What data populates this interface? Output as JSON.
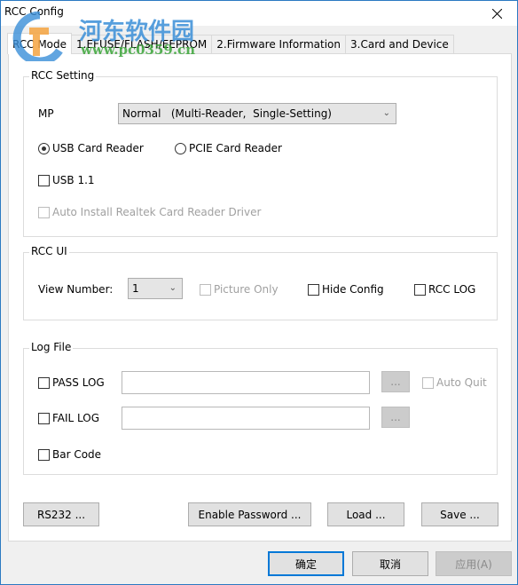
{
  "window": {
    "title": "RCC Config",
    "close_icon": "close-icon"
  },
  "watermark": {
    "text": "河东软件园",
    "url": "www.pc0359.cn"
  },
  "tabs": [
    {
      "label": "RCC Mode",
      "active": true
    },
    {
      "label": "1.EFUSE/FLASH/EEPROM",
      "active": false
    },
    {
      "label": "2.Firmware Information",
      "active": false
    },
    {
      "label": "3.Card and Device",
      "active": false
    }
  ],
  "rcc_setting": {
    "title": "RCC Setting",
    "mp_label": "MP",
    "mp_value": "Normal   (Multi-Reader,  Single-Setting)",
    "radio_usb": {
      "label": "USB Card Reader",
      "checked": true
    },
    "radio_pcie": {
      "label": "PCIE Card Reader",
      "checked": false
    },
    "usb11": {
      "label": "USB 1.1",
      "checked": false
    },
    "auto_install": {
      "label": "Auto Install Realtek Card Reader Driver",
      "checked": false,
      "disabled": true
    }
  },
  "rcc_ui": {
    "title": "RCC UI",
    "view_number_label": "View Number:",
    "view_number_value": "1",
    "picture_only": {
      "label": "Picture Only",
      "checked": false,
      "disabled": true
    },
    "hide_config": {
      "label": "Hide Config",
      "checked": false
    },
    "rcc_log": {
      "label": "RCC LOG",
      "checked": false
    }
  },
  "log_file": {
    "title": "Log File",
    "pass_log": {
      "label": "PASS LOG",
      "checked": false,
      "value": "",
      "browse": "..."
    },
    "fail_log": {
      "label": "FAIL LOG",
      "checked": false,
      "value": "",
      "browse": "..."
    },
    "auto_quit": {
      "label": "Auto Quit",
      "checked": false,
      "disabled": true
    },
    "bar_code": {
      "label": "Bar Code",
      "checked": false
    }
  },
  "panel_buttons": {
    "rs232": "RS232 ...",
    "enable_password": "Enable Password ...",
    "load": "Load ...",
    "save": "Save ..."
  },
  "dialog_buttons": {
    "ok": "确定",
    "cancel": "取消",
    "apply": "应用(A)"
  },
  "colors": {
    "accent": "#0078d7",
    "frame": "#2b79c2"
  }
}
